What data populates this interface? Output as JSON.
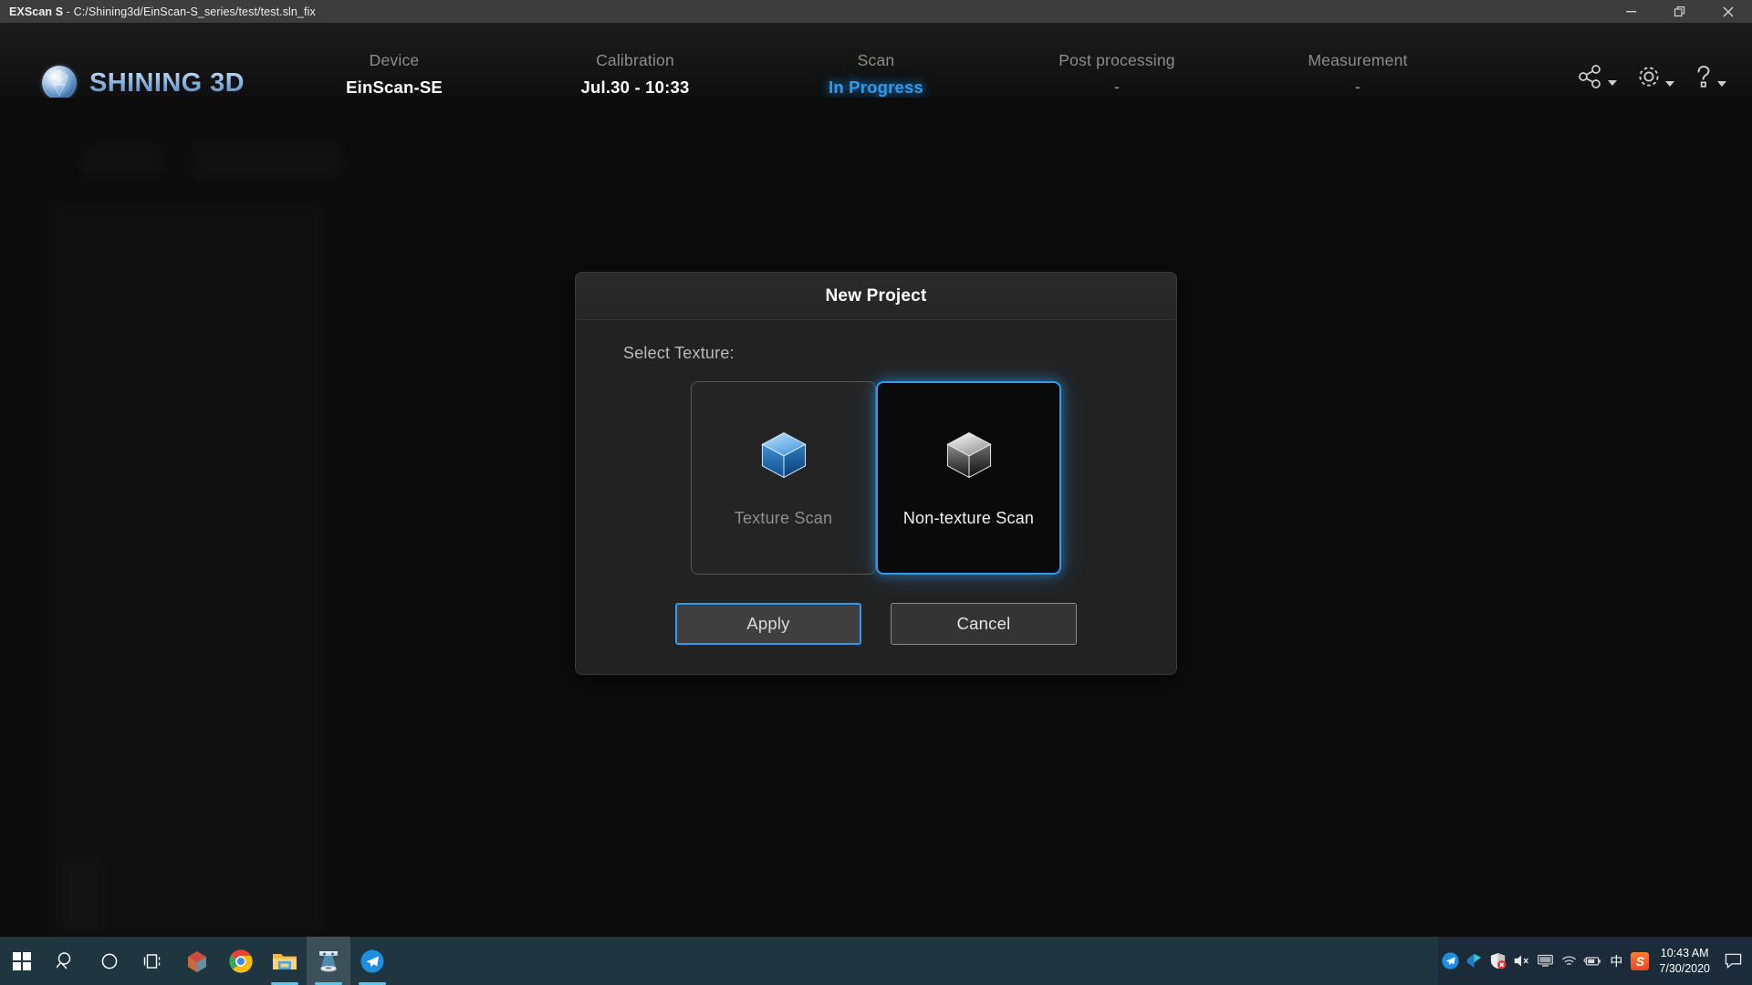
{
  "titlebar": {
    "app_name": "EXScan S",
    "separator": "-",
    "path": "C:/Shining3d/EinScan-S_series/test/test.sln_fix",
    "minimize_icon": "minimize-icon",
    "restore_icon": "restore-icon",
    "close_icon": "close-icon"
  },
  "brand": {
    "name": "SHINING 3D",
    "registered": "®",
    "gem_icon": "shining3d-gem-icon",
    "accent": "#7aa8dd"
  },
  "stepper": {
    "accent": "#2e9bf0",
    "steps": [
      {
        "label": "Device",
        "value": "EinScan-SE",
        "state": "done"
      },
      {
        "label": "Calibration",
        "value": "Jul.30 - 10:33",
        "state": "done"
      },
      {
        "label": "Scan",
        "value": "In Progress",
        "state": "active"
      },
      {
        "label": "Post processing",
        "value": "-",
        "state": "pending"
      },
      {
        "label": "Measurement",
        "value": "-",
        "state": "pending"
      }
    ]
  },
  "header_icons": [
    {
      "name": "share-icon",
      "has_caret": true
    },
    {
      "name": "gear-icon",
      "has_caret": true
    },
    {
      "name": "help-icon",
      "has_caret": true
    }
  ],
  "dialog": {
    "title": "New Project",
    "select_texture_label": "Select Texture:",
    "options": [
      {
        "label": "Texture Scan",
        "icon": "blue-cube-icon",
        "selected": false
      },
      {
        "label": "Non-texture Scan",
        "icon": "gray-cube-icon",
        "selected": true
      }
    ],
    "apply_label": "Apply",
    "cancel_label": "Cancel",
    "selected_border_color": "#2e9bf0"
  },
  "taskbar": {
    "items": [
      {
        "name": "start-button",
        "icon": "windows-logo-icon",
        "open": false,
        "active": false
      },
      {
        "name": "search-button",
        "icon": "search-icon",
        "open": false,
        "active": false
      },
      {
        "name": "cortana-button",
        "icon": "cortana-circle-icon",
        "open": false,
        "active": false
      },
      {
        "name": "task-view-button",
        "icon": "task-view-icon",
        "open": false,
        "active": false
      },
      {
        "name": "paint3d-button",
        "icon": "paint3d-icon",
        "open": false,
        "active": false
      },
      {
        "name": "chrome-button",
        "icon": "chrome-icon",
        "open": false,
        "active": false
      },
      {
        "name": "file-explorer-button",
        "icon": "folder-icon",
        "open": true,
        "active": false
      },
      {
        "name": "exscan-button",
        "icon": "3d-scanner-icon",
        "open": true,
        "active": true
      },
      {
        "name": "messenger-button",
        "icon": "blue-paperplane-icon",
        "open": true,
        "active": false
      }
    ],
    "tray": [
      {
        "name": "tray-messenger-icon",
        "icon": "blue-paperplane-icon"
      },
      {
        "name": "tray-teams-icon",
        "icon": "teal-arrow-icon"
      },
      {
        "name": "tray-defender-icon",
        "icon": "shield-warning-icon"
      },
      {
        "name": "tray-volume-icon",
        "icon": "speaker-muted-icon"
      },
      {
        "name": "tray-display-icon",
        "icon": "monitor-icon"
      },
      {
        "name": "tray-network-icon",
        "icon": "wifi-icon"
      },
      {
        "name": "tray-battery-icon",
        "icon": "battery-icon"
      }
    ],
    "ime_label": "中",
    "sogou_label": "S",
    "clock_time": "10:43 AM",
    "clock_date": "7/30/2020",
    "action_center_icon": "speech-bubble-icon"
  }
}
